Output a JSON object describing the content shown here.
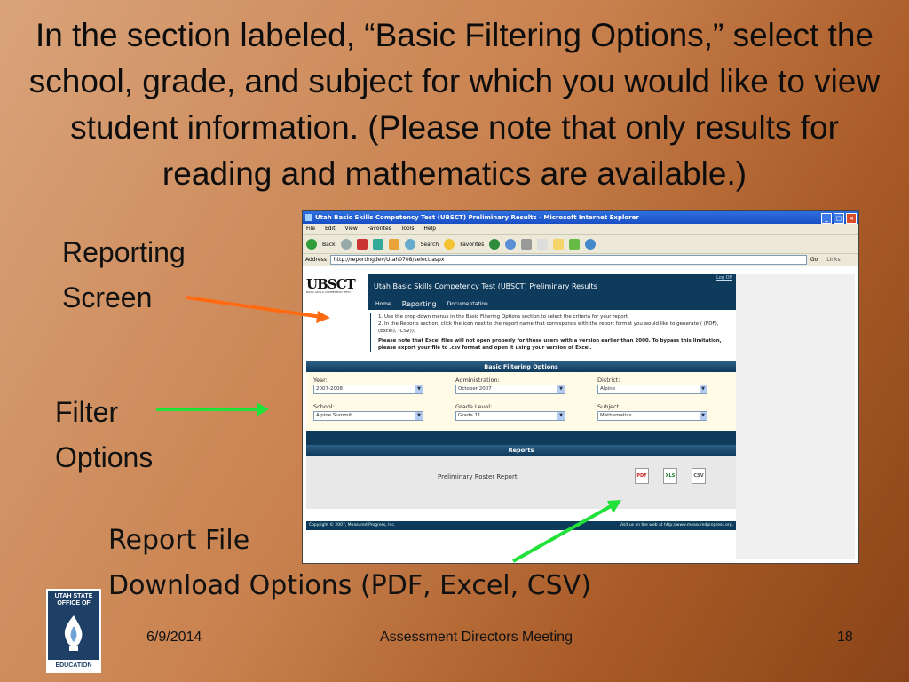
{
  "slide": {
    "title": "In the section labeled, “Basic Filtering Options,” select the school, grade, and subject for which you would like to view student information. (Please note that only results for reading and mathematics are available.)",
    "label_reporting": "Reporting",
    "label_screen": "Screen",
    "label_filter": "Filter",
    "label_options": "Options",
    "label_report_file": "Report File",
    "label_download": "Download Options (PDF, Excel, CSV)",
    "footer_date": "6/9/2014",
    "footer_meeting": "Assessment Directors Meeting",
    "footer_page": "18",
    "logo_text_top": "UTAH STATE OFFICE OF",
    "logo_text_bottom": "EDUCATION",
    "arrow_colors": {
      "orange": "#ff6a13",
      "green": "#22e03a"
    }
  },
  "browser": {
    "title": "Utah Basic Skills Competency Test (UBSCT) Preliminary Results - Microsoft Internet Explorer",
    "menu": [
      "File",
      "Edit",
      "View",
      "Favorites",
      "Tools",
      "Help"
    ],
    "back": "Back",
    "search": "Search",
    "favorites": "Favorites",
    "address_label": "Address",
    "address_value": "http://reportingdev/Utah0708/select.aspx",
    "go": "Go",
    "links": "Links"
  },
  "app": {
    "logo": "UBSCT",
    "logo_sub": "BASIC SKILLS COMPETENCY TEST",
    "header_title": "Utah Basic Skills Competency Test (UBSCT) Preliminary Results",
    "logoff": "Log Off",
    "nav": [
      "Home",
      "Reporting",
      "Documentation"
    ],
    "instr1": "1.   Use the drop-down menus in the Basic Filtering Options section to select the criteria for your report.",
    "instr2": "2.   In the Reports section, click the icon next to the report name that corresponds with the report format you would like to generate ( (PDF), (Excel), (CSV)).",
    "instr_note": "Please note that Excel files will not open properly for those users with a version earlier than 2000. To bypass this limitation, please export your file to .csv format and open it using your version of Excel.",
    "filter_header": "Basic Filtering Options",
    "filters": {
      "year_label": "Year:",
      "year_value": "2007-2008",
      "admin_label": "Administration:",
      "admin_value": "October 2007",
      "district_label": "District:",
      "district_value": "Alpine",
      "school_label": "School:",
      "school_value": "Alpine Summit",
      "grade_label": "Grade Level:",
      "grade_value": "Grade 11",
      "subject_label": "Subject:",
      "subject_value": "Mathematics"
    },
    "reports_header": "Reports",
    "report_name": "Preliminary Roster Report",
    "footer_left": "Copyright © 2007, Measured Progress, Inc.",
    "footer_right": "Visit us on the web at http://www.measuredprogress.org."
  }
}
